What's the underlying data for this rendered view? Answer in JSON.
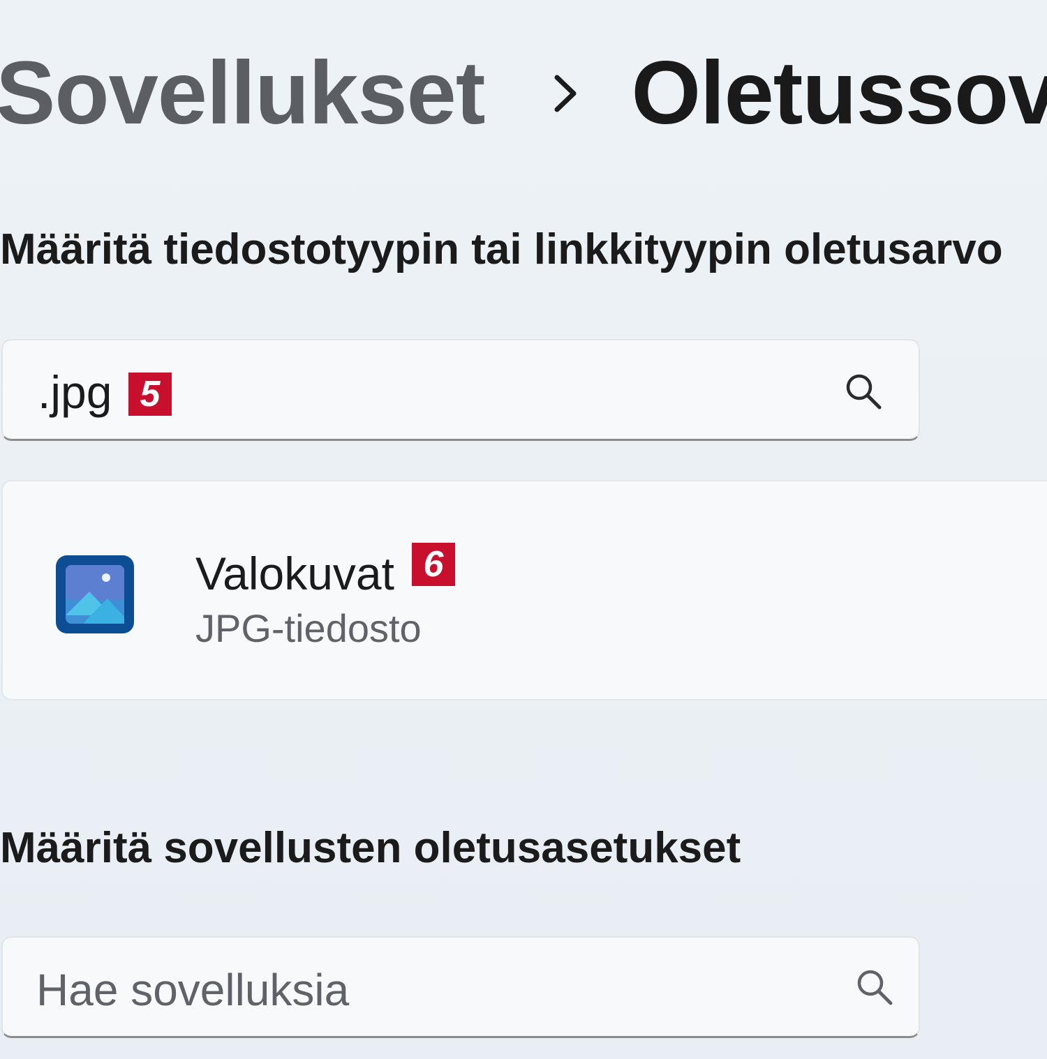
{
  "breadcrumb": {
    "parent": "Sovellukset",
    "current": "Oletussove"
  },
  "file_type_section": {
    "heading": "Määritä tiedostotyypin tai linkkityypin oletusarvo",
    "search": {
      "value": ".jpg",
      "badge": "5",
      "icon": "search-icon"
    },
    "result": {
      "app_name": "Valokuvat",
      "subtitle": "JPG-tiedosto",
      "badge": "6",
      "icon": "photos-app-icon"
    }
  },
  "app_defaults_section": {
    "heading": "Määritä sovellusten oletusasetukset",
    "search": {
      "placeholder": "Hae sovelluksia",
      "icon": "search-icon"
    }
  },
  "colors": {
    "background": "#e9eff4",
    "badge": "#c8102e",
    "photos_icon_bg": "#0c4d94"
  }
}
